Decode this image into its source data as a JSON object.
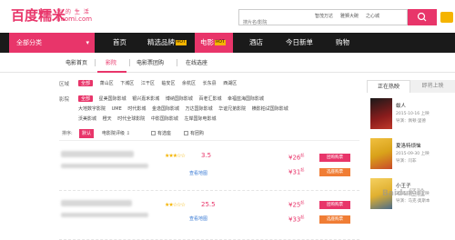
{
  "logo": {
    "text": "百度糯米",
    "tagline": "我 的 生 活",
    "domain": "nuomi.com"
  },
  "search": {
    "placeholder": "搜片名/影院",
    "hot": [
      "智茂万达",
      "雅狮大碗",
      "之心城"
    ]
  },
  "nav": {
    "all_categories": "全部分类",
    "items": [
      {
        "label": "首页"
      },
      {
        "label": "精选品牌",
        "badge": "HOT"
      },
      {
        "label": "电影",
        "badge": "HOT"
      },
      {
        "label": "酒店"
      },
      {
        "label": "今日新单"
      },
      {
        "label": "购物"
      }
    ]
  },
  "subtabs": [
    "电影首页",
    "影院",
    "电影票团购",
    "在线选座"
  ],
  "filters": {
    "area_label": "区域",
    "area_items": [
      "全部",
      "萧山区",
      "下城区",
      "江干区",
      "临安区",
      "余杭区",
      "长东县",
      "西湖区"
    ],
    "cinema_label": "影院",
    "cinema_row1": [
      "全部",
      "星美国际影城",
      "银兴嘉禾影城",
      "博纳国际影城",
      "百老汇影城",
      "幸福蓝海国际影城"
    ],
    "cinema_row2": [
      "大地数字影院",
      "UME",
      "时代影城",
      "金逸国际影城",
      "万达国际影城",
      "华谊兄弟影院",
      "横影柏试国际影城"
    ],
    "cinema_row3": [
      "沃美影城",
      "橙天",
      "时代全球影院",
      "中影国际影城",
      "左岸国际电影城"
    ],
    "sort_label": "排序:",
    "sort_default": "默认",
    "sort_rating": "电影院评级",
    "check1": "有选座",
    "check2": "有团购"
  },
  "cinemas": [
    {
      "score": "3.5",
      "map": "查看地图",
      "price1": "¥26",
      "price1_sup": "起",
      "price2": "¥31",
      "price2_sup": "起",
      "btn1": "团购购票",
      "btn2": "选座购票"
    },
    {
      "score": "25.5",
      "map": "查看地图",
      "price1": "¥25",
      "price1_sup": "起",
      "price2": "¥33",
      "price2_sup": "起",
      "btn1": "团购购票",
      "btn2": "选座购票"
    }
  ],
  "right_panel": {
    "tab_active": "正在热映",
    "tab_inactive": "即将上映",
    "movies": [
      {
        "title": "蚁人",
        "date": "2015-10-16 上映",
        "director": "导演：佩顿·里德",
        "color": "#8a1c1c"
      },
      {
        "title": "夏洛特烦恼",
        "date": "2015-09-30 上映",
        "director": "导演：闫非",
        "color": "#d9a21a"
      },
      {
        "title": "小王子",
        "date": "2015-10-16 上映",
        "director": "导演：马克·奥斯本",
        "color": "#e0b030"
      }
    ]
  },
  "watermark": "Baidu经验",
  "colors": {
    "accent": "#e8356a",
    "nav_bg": "#1a1a1a",
    "star": "#f5b400",
    "orange": "#f07d35"
  }
}
